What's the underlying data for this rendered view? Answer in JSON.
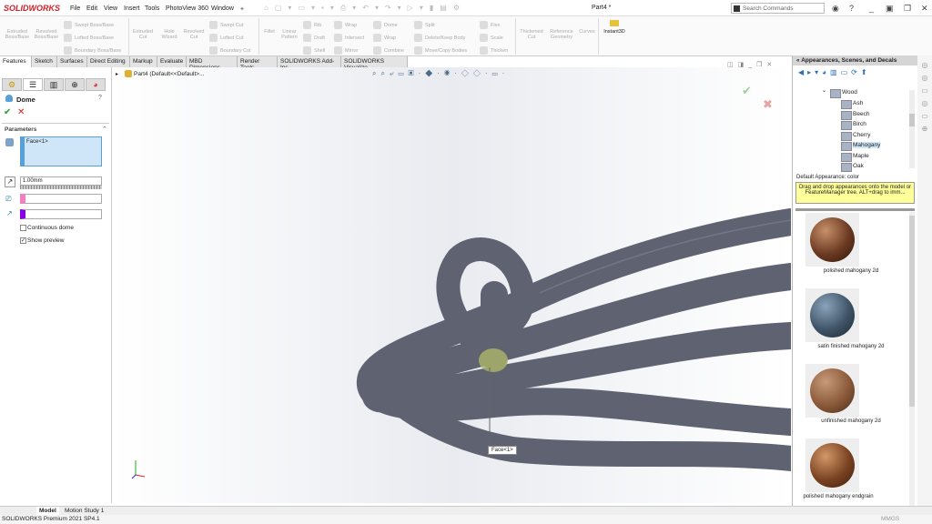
{
  "app": {
    "logo": "SOLIDWORKS",
    "title": "Part4 *",
    "search_placeholder": "Search Commands"
  },
  "menu": [
    "File",
    "Edit",
    "View",
    "Insert",
    "Tools",
    "PhotoView 360",
    "Window"
  ],
  "ribbon": {
    "big": [
      "Extruded Boss/Base",
      "Revolved Boss/Base",
      "Extruded Cut",
      "Hole Wizard",
      "Revolved Cut",
      "Fillet",
      "Linear Pattern",
      "Thickened Cut",
      "Reference Geometry",
      "Curves",
      "Instant3D"
    ],
    "small": [
      "Swept Boss/Base",
      "Lofted Boss/Base",
      "Boundary Boss/Base",
      "Swept Cut",
      "Lofted Cut",
      "Boundary Cut",
      "Rib",
      "Draft",
      "Shell",
      "Wrap",
      "Intersect",
      "Mirror",
      "Dome",
      "Wrap",
      "Combine",
      "Split",
      "Delete/Keep Body",
      "Move/Copy Bodies",
      "Flex",
      "Scale",
      "Thicken"
    ]
  },
  "tabs": [
    "Features",
    "Sketch",
    "Surfaces",
    "Direct Editing",
    "Markup",
    "Evaluate",
    "MBD Dimensions",
    "Render Tools",
    "SOLIDWORKS Add-Ins",
    "SOLIDWORKS Visualize"
  ],
  "property_manager": {
    "title": "Dome",
    "section": "Parameters",
    "face": "Face<1>",
    "distance": "1.00mm",
    "continuous_dome": "Continuous dome",
    "continuous_checked": false,
    "show_preview": "Show preview",
    "preview_checked": true,
    "colors": {
      "pink": "#f27fbf",
      "purple": "#8a00e6",
      "selection": "#cfe6f8"
    }
  },
  "tree": {
    "part": "Part4  (Default<<Default>..."
  },
  "viewport": {
    "callout": "Face<1>",
    "model_color": "#5e6271"
  },
  "appearances": {
    "title": "Appearances, Scenes, and Decals",
    "folder": "Wood",
    "items": [
      "Ash",
      "Beech",
      "Birch",
      "Cherry",
      "Mahogany",
      "Maple",
      "Oak"
    ],
    "selected": "Mahogany",
    "default_label": "Default Appearance: color",
    "tip": "Drag and drop appearances onto the model or FeatureManager tree.  ALT+drag to imm...",
    "swatches": [
      {
        "name": "polished mahogany 2d",
        "color": "#6b3a22"
      },
      {
        "name": "satin finished mahogany 2d",
        "color": "#3f5467"
      },
      {
        "name": "unfinished mahogany 2d",
        "color": "#8a5a3a"
      },
      {
        "name": "polished mahogany endgrain",
        "color": "#7a4322"
      }
    ]
  },
  "bottom_tabs": [
    "Model",
    "Motion Study 1"
  ],
  "status": {
    "text": "SOLIDWORKS Premium 2021 SP4.1",
    "units": "MMGS"
  }
}
